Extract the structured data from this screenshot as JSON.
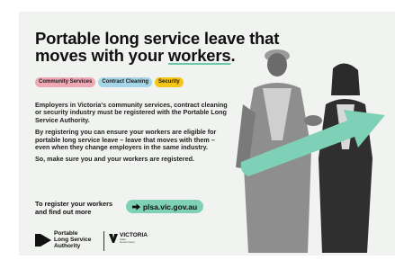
{
  "headline": {
    "line1": "Portable long service leave that",
    "line2_pre": "moves with your ",
    "line2_underlined": "workers",
    "line2_post": "."
  },
  "tags": [
    "Community Services",
    "Contract Cleaning",
    "Security"
  ],
  "body": [
    "Employers in Victoria's community services, contract cleaning or security industry must be registered with the Portable Long Service Authority.",
    "By registering you can ensure your workers are eligible for portable long service leave – leave that moves with them – even when they change employers in the same industry.",
    "So, make sure you and your workers are registered."
  ],
  "cta": {
    "text_line1": "To register your workers",
    "text_line2": "and find out more",
    "button_label": "plsa.vic.gov.au"
  },
  "logos": {
    "plsa_line1": "Portable",
    "plsa_line2": "Long Service",
    "plsa_line3": "Authority",
    "victoria": "VICTORIA",
    "victoria_sub1": "State",
    "victoria_sub2": "Government"
  },
  "colors": {
    "accent_green": "#7ed1b6",
    "tag_community": "#f0a8b4",
    "tag_cleaning": "#a5d6e8",
    "tag_security": "#f5c518"
  }
}
